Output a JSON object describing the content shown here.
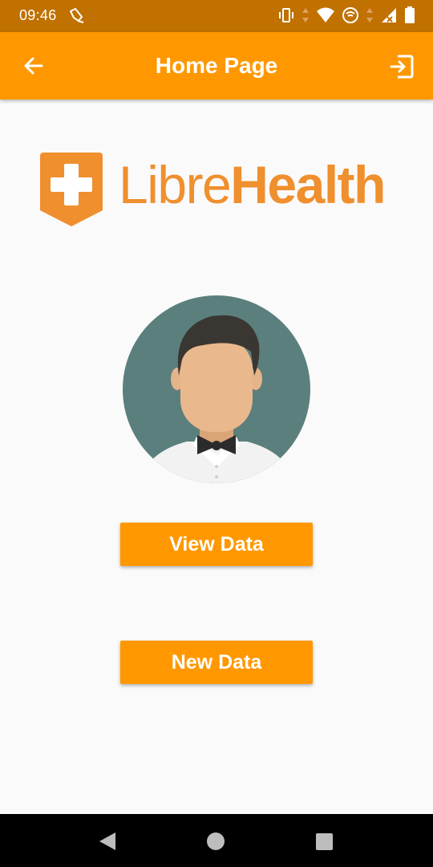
{
  "status_bar": {
    "time": "09:46",
    "icons": [
      "accessibility-icon",
      "vibrate-icon",
      "data-arrows-icon",
      "wifi-icon",
      "hotspot-icon",
      "signal-icon",
      "battery-icon"
    ]
  },
  "app_bar": {
    "title": "Home Page",
    "back_icon": "arrow-left-icon",
    "logout_icon": "exit-to-app-icon"
  },
  "logo": {
    "text_light": "Libre",
    "text_bold": "Health",
    "brand_color": "#ef8f2e"
  },
  "avatar": {
    "icon": "user-avatar-icon",
    "background": "#5b7f7c"
  },
  "buttons": {
    "view_data": "View Data",
    "new_data": "New Data"
  },
  "colors": {
    "primary": "#ff9800",
    "status_bar": "#c07100",
    "background": "#fafafa"
  },
  "nav_bar": {
    "items": [
      "nav-back-icon",
      "nav-home-icon",
      "nav-recents-icon"
    ]
  }
}
